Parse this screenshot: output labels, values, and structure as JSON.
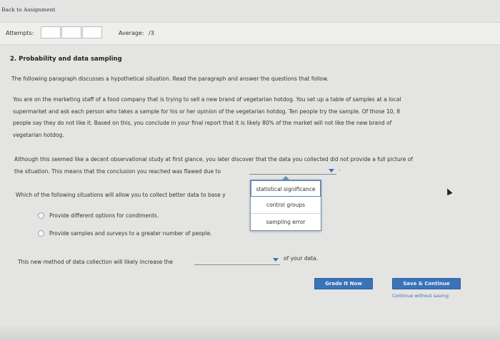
{
  "nav": {
    "back_link": "Back to Assignment"
  },
  "attempts": {
    "label": "Attempts:",
    "average_label": "Average:",
    "average_value": "/3"
  },
  "question": {
    "title": "2. Probability and data sampling",
    "intro": "The following paragraph discusses a hypothetical situation. Read the paragraph and answer the questions that follow.",
    "paragraph_lines": [
      "You are on the marketing staff of a food company that is trying to sell a new brand of vegetarian hotdog. You set up a table of samples at a local",
      "supermarket and ask each person who takes a sample for his or her opinion of the vegetarian hotdog. Ten people try the sample. Of those 10, 8",
      "people say they do not like it. Based on this, you conclude in your final report that it is likely 80% of the market will not like the new brand of",
      "vegetarian hotdog."
    ],
    "part1_line1": "Although this seemed like a decent observational study at first glance, you later discover that the data you collected did not provide a full picture of",
    "part1_line2": "the situation. This means that the conclusion you reached was flawed due to",
    "part1_period": ".",
    "dropdown_options": [
      "statistical significance",
      "control groups",
      "sampling error"
    ],
    "part2_question": "Which of the following situations will allow you to collect better data to base y",
    "radio_options": [
      "Provide different options for condiments.",
      "Provide samples and surveys to a greater number of people."
    ],
    "part3_prefix": "This new method of data collection will likely increase the",
    "part3_suffix": "of your data."
  },
  "actions": {
    "grade_button": "Grade It Now",
    "save_button": "Save & Continue",
    "continue_link": "Continue without saving"
  },
  "colors": {
    "accent": "#3b73b9",
    "background": "#e4e4e2"
  }
}
